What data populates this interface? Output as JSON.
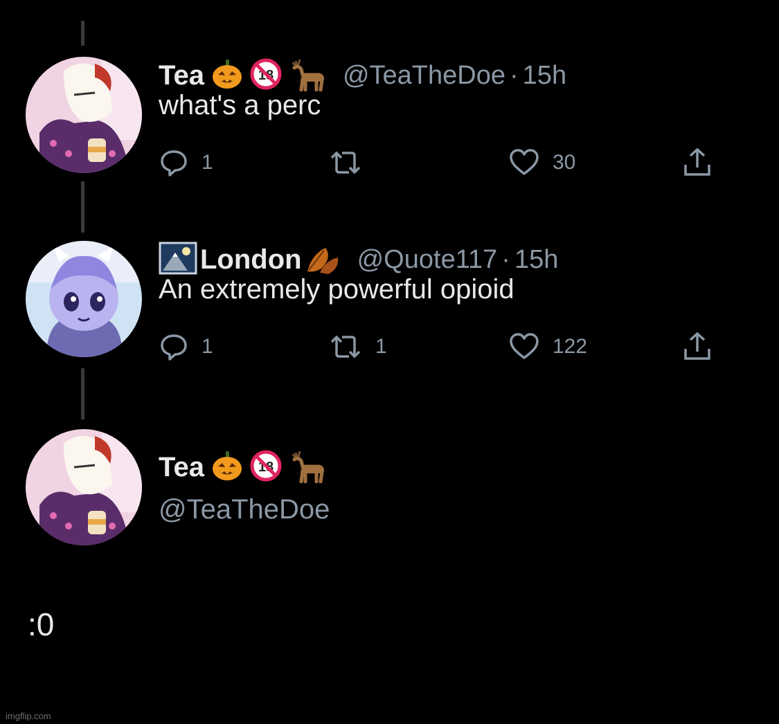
{
  "colors": {
    "background": "#000000",
    "text_primary": "#e7e9ea",
    "text_secondary": "#8b98a5",
    "thread_line": "#3a3a3a"
  },
  "tweets": [
    {
      "display_name": "Tea",
      "emojis": [
        "pumpkin-emoji",
        "no-under-18-emoji",
        "deer-emoji"
      ],
      "handle": "@TeaTheDoe",
      "separator": "·",
      "time": "15h",
      "text": "what's a perc",
      "replies": "1",
      "retweets": "",
      "likes": "30"
    },
    {
      "display_name": "London",
      "emojis": [
        "mountain-picture-emoji",
        "fallen-leaf-emoji"
      ],
      "handle": "@Quote117",
      "separator": "·",
      "time": "15h",
      "text": "An extremely powerful opioid",
      "replies": "1",
      "retweets": "1",
      "likes": "122"
    }
  ],
  "composer": {
    "display_name": "Tea",
    "emojis": [
      "pumpkin-emoji",
      "no-under-18-emoji",
      "deer-emoji"
    ],
    "handle": "@TeaTheDoe"
  },
  "caption": ":0",
  "watermark": "imgflip.com"
}
